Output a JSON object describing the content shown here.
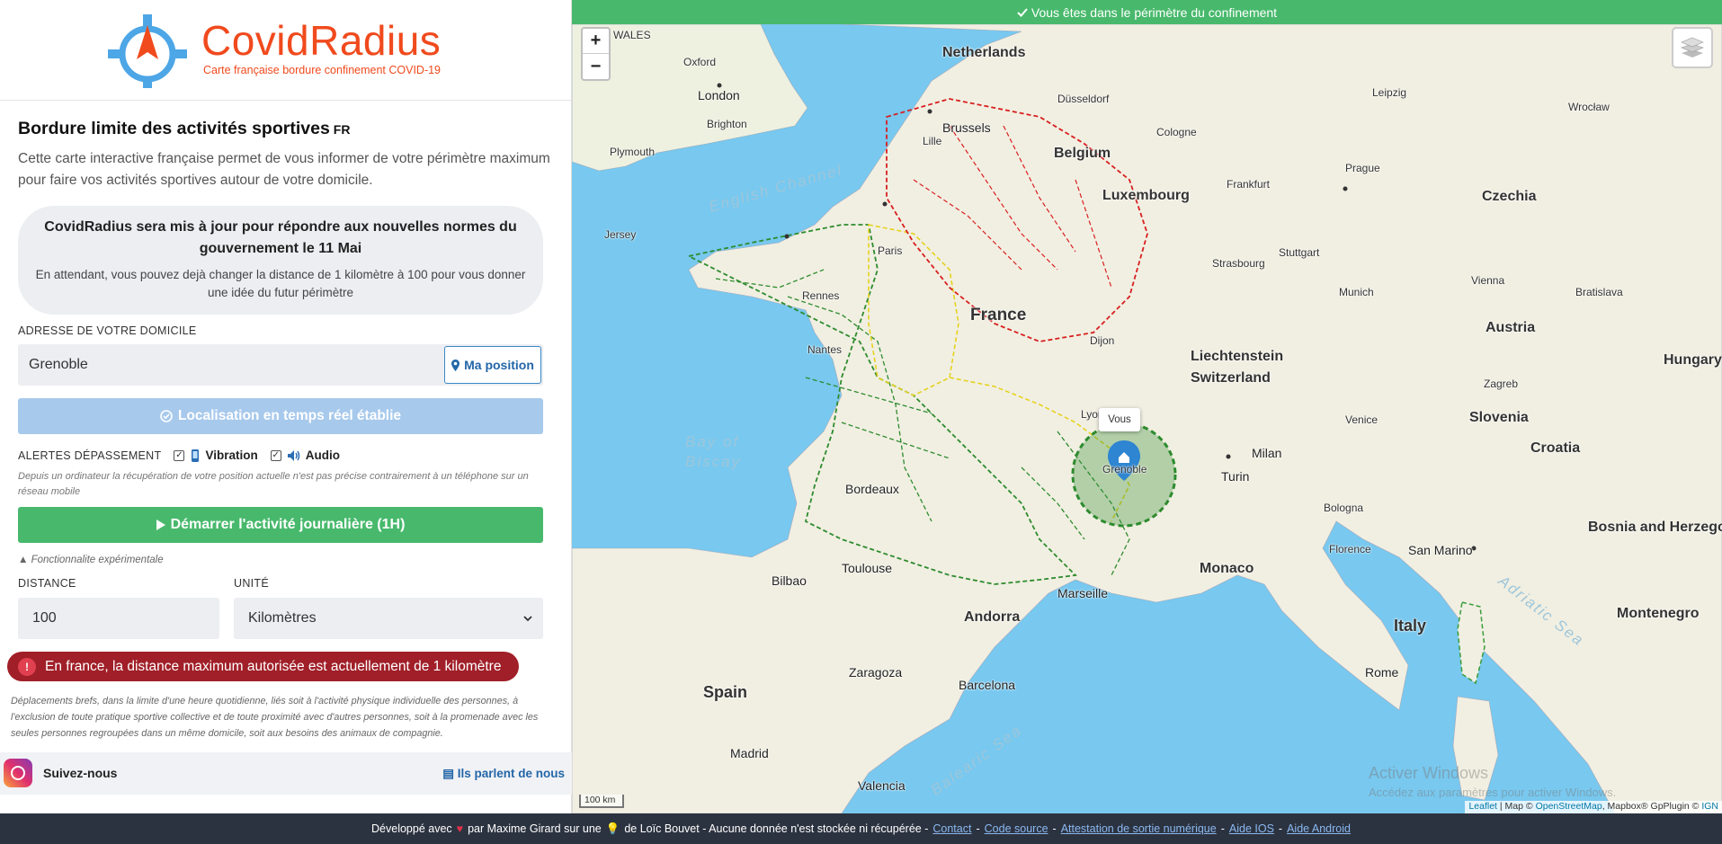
{
  "brand": {
    "title": "CovidRadius",
    "subtitle": "Carte française bordure confinement COVID-19"
  },
  "section": {
    "title": "Bordure limite des activités sportives",
    "lang": "FR",
    "description": "Cette carte interactive française permet de vous informer de votre périmètre maximum pour faire vos activités sportives autour de votre domicile."
  },
  "update": {
    "title": "CovidRadius sera mis à jour pour répondre aux nouvelles normes du gouvernement le 11 Mai",
    "text": "En attendant, vous pouvez dejà changer la distance de 1 kilomètre à 100 pour vous donner une idée du futur périmètre"
  },
  "address": {
    "label": "ADRESSE DE VOTRE DOMICILE",
    "value": "Grenoble",
    "position_button": "Ma position"
  },
  "location_button": "Localisation en temps réel établie",
  "alerts": {
    "label": "ALERTES DÉPASSEMENT",
    "vibration": "Vibration",
    "audio": "Audio",
    "vibration_checked": true,
    "audio_checked": true
  },
  "alerts_note": "Depuis un ordinateur la récupération de votre position actuelle n'est pas précise contrairement à un téléphone sur un réseau mobile",
  "start_button": "Démarrer l'activité journalière (1H)",
  "experimental_note": "Fonctionnalite expérimentale",
  "distance": {
    "label": "DISTANCE",
    "value": "100"
  },
  "unit": {
    "label": "UNITÉ",
    "value": "Kilomètres"
  },
  "max_alert": "En france, la distance maximum autorisée est actuellement de 1 kilomètre",
  "legal": "Déplacements brefs, dans la limite d'une heure quotidienne, liés soit à l'activité physique individuelle des personnes, à l'exclusion de toute pratique sportive collective et de toute proximité avec d'autres personnes, soit à la promenade avec les seules personnes regroupées dans un même domicile, soit aux besoins des animaux de compagnie.",
  "follow": {
    "label": "Suivez-nous",
    "press_link": "Ils parlent de nous"
  },
  "map": {
    "status": "Vous êtes dans le périmètre du confinement",
    "zoom_in": "+",
    "zoom_out": "−",
    "popup": "Vous",
    "scale": "100 km",
    "attribution": {
      "leaflet": "Leaflet",
      "map": "| Map ©",
      "osm": "OpenStreetMap",
      "mapbox": ", Mapbox® GpPlugin ©",
      "ign": "IGN"
    },
    "watermark_title": "Activer Windows",
    "watermark_text": "Accédez aux paramètres pour activer Windows.",
    "labels": {
      "netherlands": "Netherlands",
      "belgium": "Belgium",
      "luxembourg": "Luxembourg",
      "france": "France",
      "switzerland": "Switzerland",
      "liechtenstein": "Liechtenstein",
      "austria": "Austria",
      "czechia": "Czechia",
      "hungary": "Hungary",
      "slovenia": "Slovenia",
      "croatia": "Croatia",
      "italy": "Italy",
      "spain": "Spain",
      "andorra": "Andorra",
      "monaco": "Monaco",
      "san_marino": "San Marino",
      "bosnia": "Bosnia and Herzegovina",
      "montenegro": "Montenegro",
      "wales": "WALES",
      "english_channel": "English Channel",
      "bay_of_biscay_1": "Bay of",
      "bay_of_biscay_2": "Biscay",
      "balearic_sea": "Balearic Sea",
      "adriatic_sea": "Adriatic Sea",
      "london": "London",
      "paris": "Paris",
      "brussels": "Brussels",
      "frankfurt": "Frankfurt",
      "munich": "Munich",
      "prague": "Prague",
      "vienna": "Vienna",
      "milan": "Milan",
      "turin": "Turin",
      "marseille": "Marseille",
      "barcelona": "Barcelona",
      "madrid": "Madrid",
      "rome": "Rome",
      "florence": "Florence",
      "bordeaux": "Bordeaux",
      "lyon": "Lyon",
      "grenoble": "Grenoble",
      "toulouse": "Toulouse",
      "nantes": "Nantes",
      "rennes": "Rennes",
      "lille": "Lille",
      "strasbourg": "Strasbourg",
      "dijon": "Dijon",
      "zaragoza": "Zaragoza",
      "jersey": "Jersey",
      "bilbao": "Bilbao",
      "valencia": "Valencia",
      "bologna": "Bologna",
      "venice": "Venice",
      "zagreb": "Zagreb",
      "stuttgart": "Stuttgart",
      "cologne": "Cologne",
      "dusseldorf": "Düsseldorf",
      "plymouth": "Plymouth",
      "brighton": "Brighton",
      "oxford": "Oxford",
      "bratislava": "Bratislava",
      "wroclaw": "Wrocław",
      "leipzig": "Leipzig"
    }
  },
  "footer": {
    "developed": "Développé avec",
    "by": "par Maxime Girard sur une",
    "of": "de Loïc Bouvet - Aucune donnée n'est stockée ni récupérée -",
    "contact": "Contact",
    "source": "Code source",
    "attestation": "Attestation de sortie numérique",
    "ios": "Aide IOS",
    "android": "Aide Android"
  },
  "colors": {
    "brand": "#f04a1d",
    "green": "#48b96c",
    "blue_light": "#a7c9ec",
    "alert_red": "#a01f28",
    "footer_bg": "#2c3340",
    "water": "#78c8ef",
    "land": "#f1efe2"
  }
}
